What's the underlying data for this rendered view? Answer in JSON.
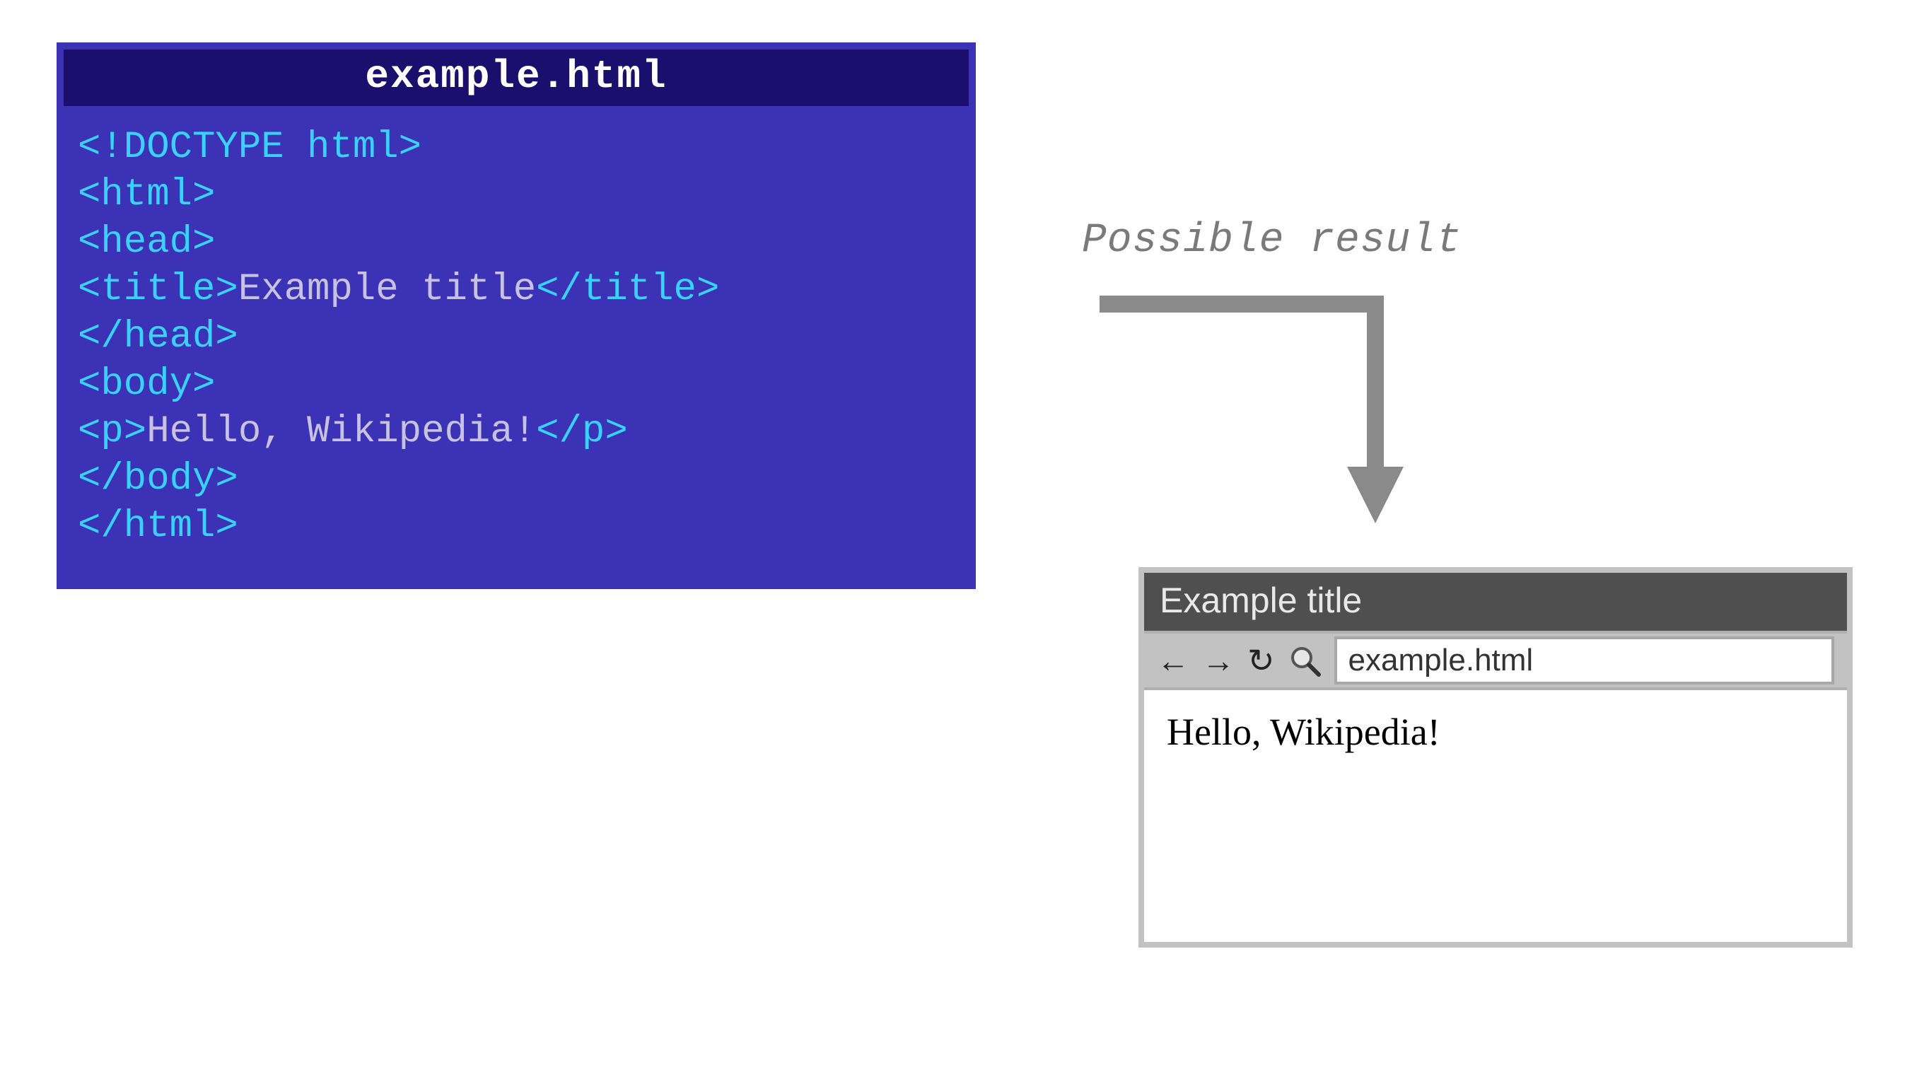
{
  "code_panel": {
    "filename": "example.html",
    "l1_doctype": "<!DOCTYPE html>",
    "l2_html_open": "<html>",
    "l3_head_open": "<head>",
    "l4_title_open": "<title>",
    "l4_title_text": "Example title",
    "l4_title_close": "</title>",
    "l5_head_close": "</head>",
    "l6_body_open": "<body>",
    "l7_p_open": "<p>",
    "l7_p_text": "Hello, Wikipedia!",
    "l7_p_close": "</p>",
    "l8_body_close": "</body>",
    "l9_html_close": "</html>"
  },
  "caption": "Possible result",
  "browser": {
    "title": "Example title",
    "back_glyph": "←",
    "fwd_glyph": "→",
    "reload_glyph": "↻",
    "address": "example.html",
    "content": "Hello, Wikipedia!"
  }
}
